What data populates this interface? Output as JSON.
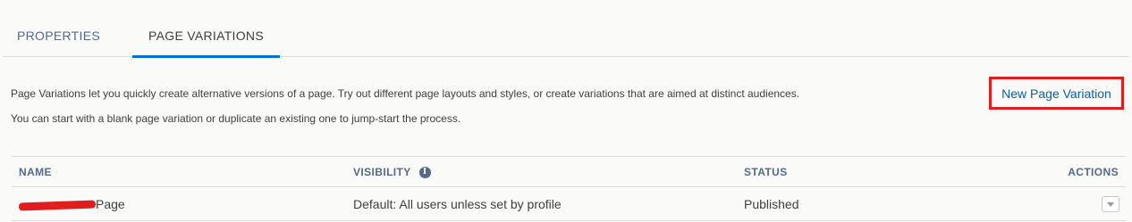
{
  "tabs": {
    "properties": "PROPERTIES",
    "page_variations": "PAGE VARIATIONS"
  },
  "description": {
    "line1": "Page Variations let you quickly create alternative versions of a page. Try out different page layouts and styles, or create variations that are aimed at distinct audiences.",
    "line2": "You can start with a blank page variation or duplicate an existing one to jump-start the process."
  },
  "new_variation_label": "New Page Variation",
  "table": {
    "headers": {
      "name": "NAME",
      "visibility": "VISIBILITY",
      "status": "STATUS",
      "actions": "ACTIONS"
    },
    "rows": [
      {
        "name_suffix": "Page",
        "visibility": "Default: All users unless set by profile",
        "status": "Published"
      }
    ]
  },
  "icons": {
    "info": "info-icon",
    "row_menu": "chevron-down-icon"
  },
  "colors": {
    "accent": "#0070d2",
    "link": "#0b5cab",
    "highlight_box": "#e01e1e",
    "header_text": "#54698d"
  }
}
